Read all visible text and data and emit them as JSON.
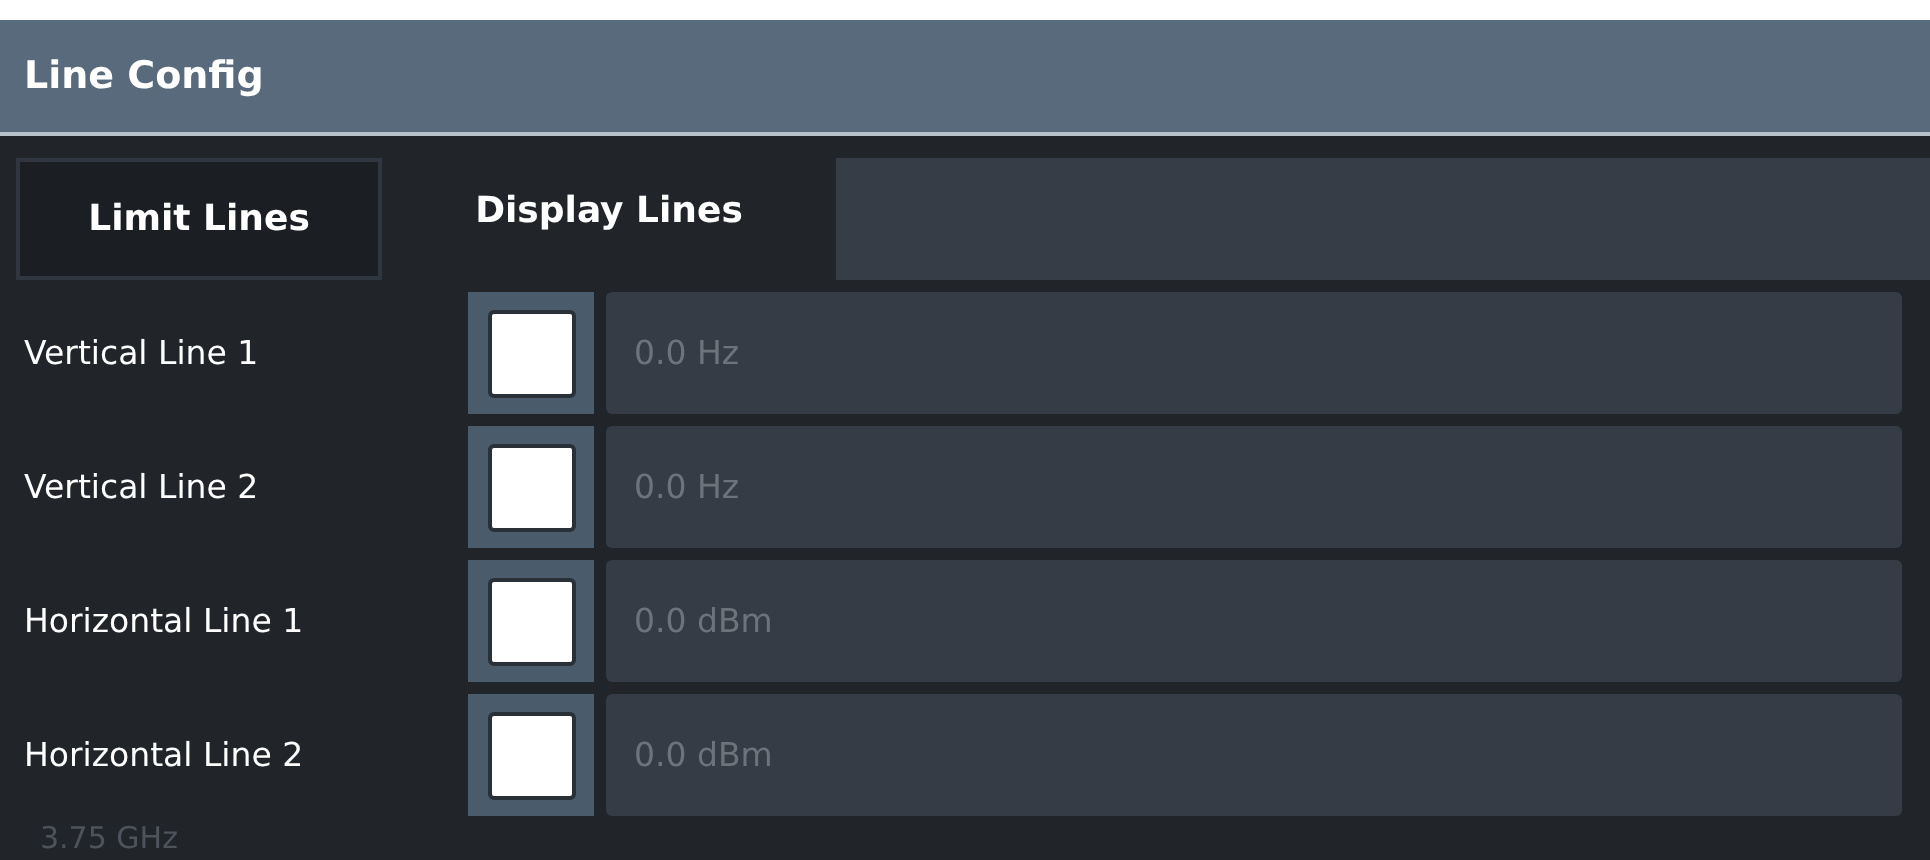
{
  "dialog": {
    "title": "Line Config"
  },
  "tabs": [
    {
      "label": "Limit Lines",
      "selected": false
    },
    {
      "label": "Display Lines",
      "selected": true
    }
  ],
  "lines": [
    {
      "label": "Vertical Line 1",
      "checked": false,
      "value": "0.0 Hz"
    },
    {
      "label": "Vertical Line 2",
      "checked": false,
      "value": "0.0 Hz"
    },
    {
      "label": "Horizontal Line 1",
      "checked": false,
      "value": "0.0 dBm"
    },
    {
      "label": "Horizontal Line 2",
      "checked": false,
      "value": "0.0 dBm"
    }
  ],
  "background": {
    "frequency_label": "3.75 GHz"
  }
}
